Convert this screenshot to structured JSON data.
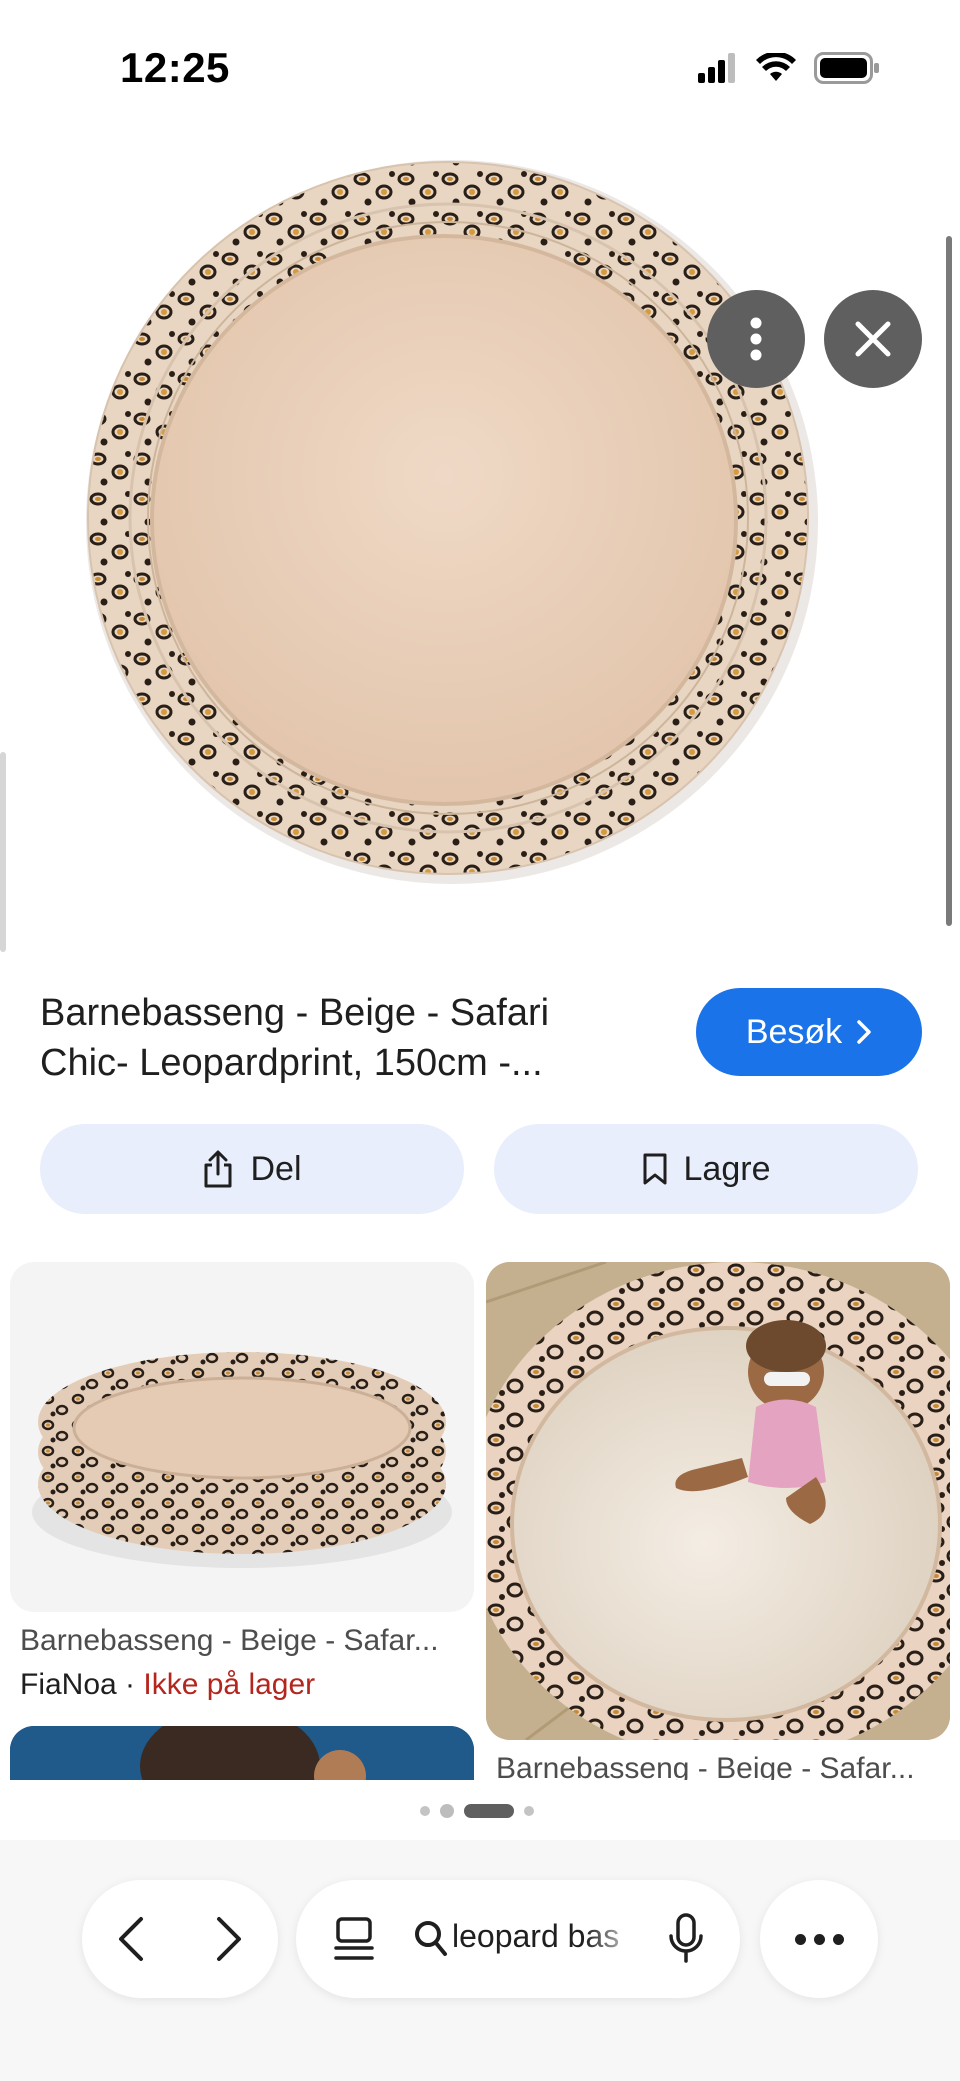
{
  "status_bar": {
    "time": "12:25",
    "icons": [
      "cellular-signal-icon",
      "wifi-icon",
      "battery-icon"
    ]
  },
  "hero": {
    "image": "leopard-print-kiddie-pool",
    "actions": {
      "more_icon": "vertical-dots-icon",
      "close_icon": "close-icon"
    },
    "lens_icon": "google-lens-icon"
  },
  "result": {
    "title": "Barnebasseng - Beige - Safari Chic- Leopardprint, 150cm -...",
    "visit_label": "Besøk",
    "share_label": "Del",
    "save_label": "Lagre"
  },
  "related": [
    {
      "title": "Barnebasseng - Beige - Safar...",
      "source": "FiaNoa",
      "separator": " · ",
      "stock": "Ikke på lager"
    },
    {
      "title": "Barnebasseng - Beige - Safar..."
    }
  ],
  "toolbar": {
    "search_query": "leopard bas",
    "icons": [
      "back-arrow-icon",
      "forward-arrow-icon",
      "tabs-icon",
      "search-icon",
      "mic-icon",
      "more-horizontal-icon"
    ]
  },
  "colors": {
    "accent": "#1a73e8",
    "pill_bg": "#e8eefb",
    "stock_red": "#b3261e",
    "overlay_button": "#5f5f5f"
  }
}
